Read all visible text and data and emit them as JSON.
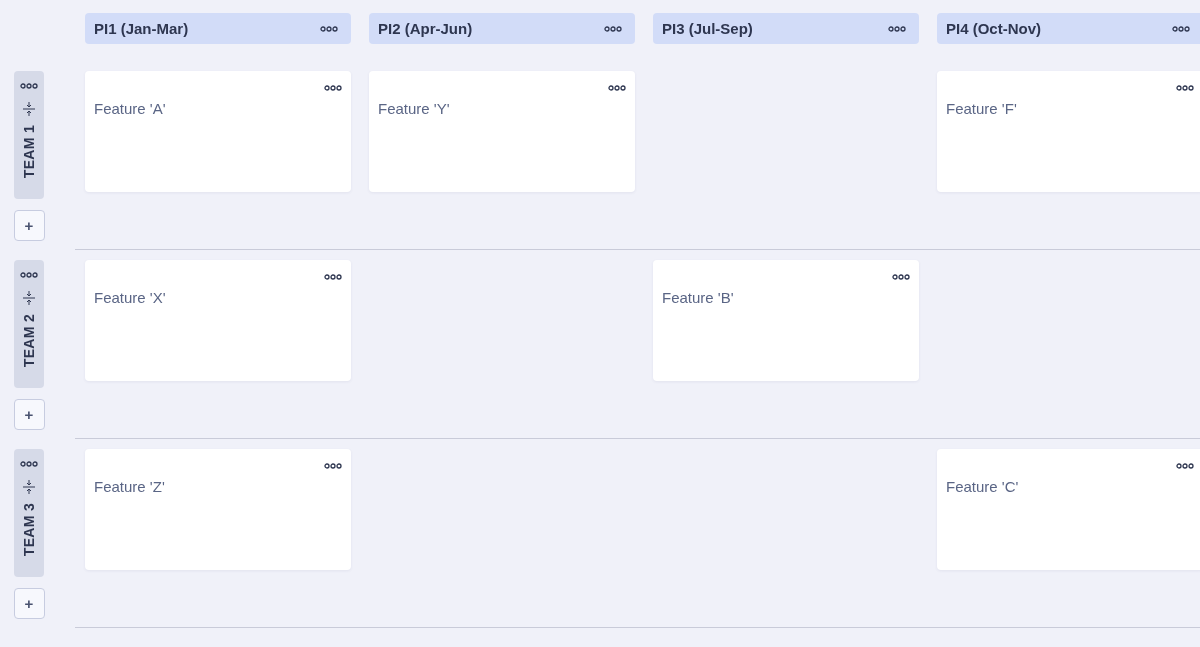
{
  "periods": [
    {
      "label": "PI1 (Jan-Mar)"
    },
    {
      "label": "PI2 (Apr-Jun)"
    },
    {
      "label": "PI3 (Jul-Sep)"
    },
    {
      "label": "PI4 (Oct-Nov)"
    }
  ],
  "teams": [
    {
      "label": "TEAM 1",
      "add": "+",
      "cells": [
        {
          "kind": "card",
          "title": "Feature 'A'"
        },
        {
          "kind": "card",
          "title": "Feature 'Y'"
        },
        {
          "kind": "empty"
        },
        {
          "kind": "card",
          "title": "Feature 'F'"
        }
      ]
    },
    {
      "label": "TEAM 2",
      "add": "+",
      "cells": [
        {
          "kind": "card",
          "title": "Feature 'X'"
        },
        {
          "kind": "empty"
        },
        {
          "kind": "card",
          "title": "Feature 'B'"
        },
        {
          "kind": "empty"
        }
      ]
    },
    {
      "label": "TEAM 3",
      "add": "+",
      "cells": [
        {
          "kind": "card",
          "title": "Feature 'Z'"
        },
        {
          "kind": "empty"
        },
        {
          "kind": "empty"
        },
        {
          "kind": "card",
          "title": "Feature 'C'"
        }
      ]
    }
  ]
}
